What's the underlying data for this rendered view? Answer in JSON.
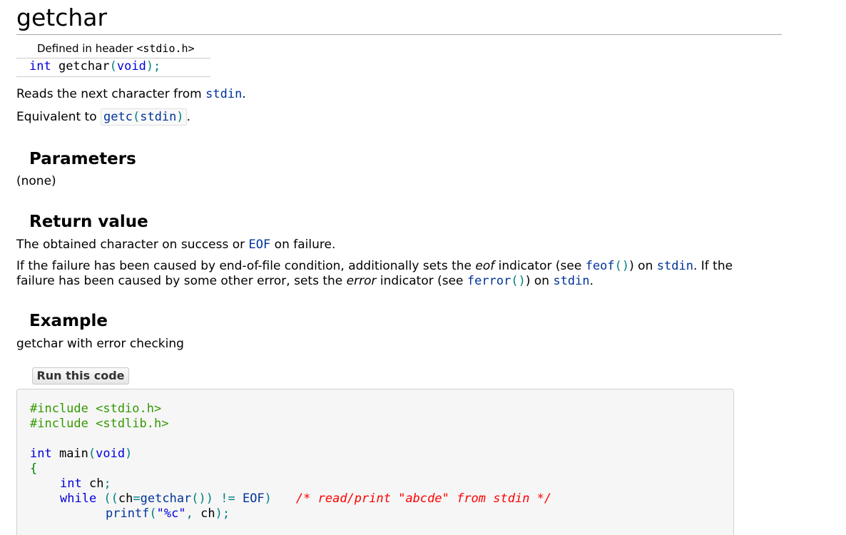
{
  "title": "getchar",
  "header": {
    "defined_prefix": "Defined in header ",
    "header_name": "<stdio.h>"
  },
  "declaration": {
    "type": "int",
    "name": " getchar",
    "open": "(",
    "param": "void",
    "close": ");"
  },
  "description": {
    "line1_text": "Reads the next character from ",
    "line1_link": "stdin",
    "line1_end": ".",
    "line2_text": "Equivalent to ",
    "line2_code_fn": "getc",
    "line2_code_open": "(",
    "line2_code_arg": "stdin",
    "line2_code_close": ")",
    "line2_end": "."
  },
  "parameters": {
    "heading": "Parameters",
    "text": "(none)"
  },
  "return_value": {
    "heading": "Return value",
    "line1_a": "The obtained character on success or ",
    "line1_link": "EOF",
    "line1_b": " on failure.",
    "p2_a": "If the failure has been caused by end-of-file condition, additionally sets the ",
    "p2_em1": "eof",
    "p2_b": " indicator (see ",
    "p2_link1": "feof",
    "p2_link1_parens": "()",
    "p2_c": ") on ",
    "p2_link2": "stdin",
    "p2_d": ". If the",
    "p2_line2_a": "failure has been caused by some other error, sets the ",
    "p2_em2": "error",
    "p2_line2_b": " indicator (see ",
    "p2_link3": "ferror",
    "p2_link3_parens": "()",
    "p2_line2_c": ") on ",
    "p2_link4": "stdin",
    "p2_line2_d": "."
  },
  "example": {
    "heading": "Example",
    "caption": "getchar with error checking",
    "run_label": "Run this code",
    "code": {
      "l1": "#include <stdio.h>",
      "l2": "#include <stdlib.h>",
      "l4_kw": "int",
      "l4_name": " main",
      "l4_open": "(",
      "l4_param": "void",
      "l4_close": ")",
      "l5": "{",
      "l6_kw": "int",
      "l6_rest": " ch",
      "l6_semi": ";",
      "l7_kw": "while",
      "l7_a": " ((",
      "l7_b": "ch",
      "l7_c": "=",
      "l7_d": "getchar",
      "l7_e": "()) != ",
      "l7_f": "EOF",
      "l7_g": ")",
      "l7_comment": "/* read/print \"abcde\" from stdin */",
      "l8_fn": "printf",
      "l8_open": "(",
      "l8_str": "\"%c\"",
      "l8_comma": ", ",
      "l8_arg": "ch",
      "l8_close": ");"
    }
  },
  "colors": {
    "keyword": "#0000dd",
    "link": "#003399",
    "preprocessor": "#339900",
    "comment": "#ff0000",
    "brace": "#008000"
  }
}
